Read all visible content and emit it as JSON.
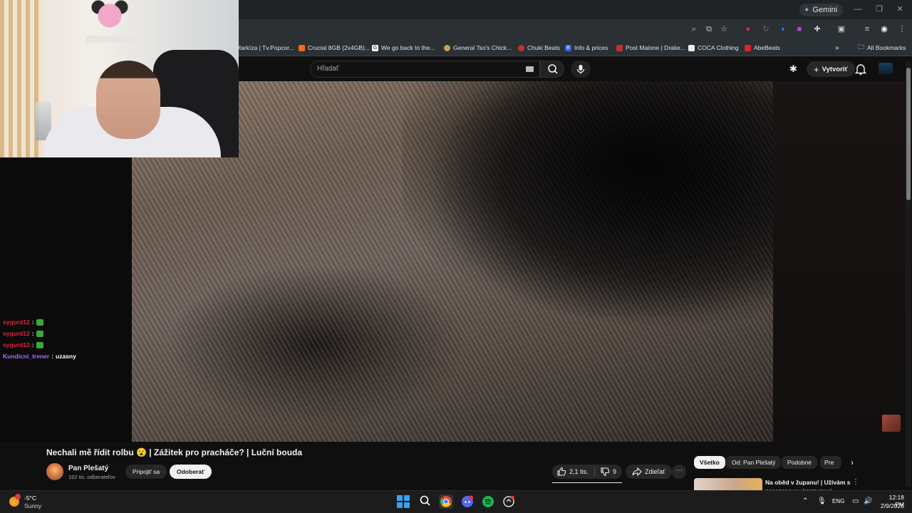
{
  "browser": {
    "gemini_label": "Gemini",
    "bookmarks": [
      {
        "label": "Markíza | Tv.Popcor...",
        "color": "#2d6cdf"
      },
      {
        "label": "Crucial 8GB (2x4GB)...",
        "color": "#f06a1f"
      },
      {
        "label": "We go back to the...",
        "color": "#ffffff"
      },
      {
        "label": "General Tso's Chick...",
        "color": "#c7a35a"
      },
      {
        "label": "Chuki Beats",
        "color": "#c62f2f"
      },
      {
        "label": "Info & prices",
        "color": "#2f5fe0"
      },
      {
        "label": "Post Malone | Drake...",
        "color": "#c62f2f"
      },
      {
        "label": "COCA Clothing",
        "color": "#1a1a1a"
      },
      {
        "label": "AbeBeats",
        "color": "#e0242b"
      }
    ],
    "all_bookmarks_label": "All Bookmarks"
  },
  "youtube": {
    "search_placeholder": "Hľadať",
    "create_label": "Vytvoriť"
  },
  "overlay": {
    "chat": [
      {
        "user": "sygurd12",
        "message": ""
      },
      {
        "user": "sygurd12",
        "message": ""
      },
      {
        "user": "sygurd12",
        "message": ""
      },
      {
        "user": "Kundicni_trener",
        "message": "uzasny"
      }
    ]
  },
  "video": {
    "title": "Nechali mě řídit rolbu 😮 | Zážitek pro pracháče? | Luční bouda",
    "channel_name": "Pan Plešatý",
    "channel_subs": "162 tis. odberateľov",
    "join_label": "Pripojiť sa",
    "subscribe_label": "Odoberať",
    "likes": "2,1 tis.",
    "dislikes": "9",
    "share_label": "Zdieľať"
  },
  "sidebar": {
    "chips": [
      "Všetko",
      "Od: Pan Plešatý",
      "Podobné",
      "Pre"
    ],
    "recommendation_title": "Na oběd v županu! | Užívám si",
    "recommendation_title_line2": "posezonovou konzumaci"
  },
  "taskbar": {
    "weather_temp": "-5°C",
    "weather_condition": "Sunny",
    "language": "ENG",
    "time": "12:18 PM",
    "date": "2/9/2026"
  }
}
